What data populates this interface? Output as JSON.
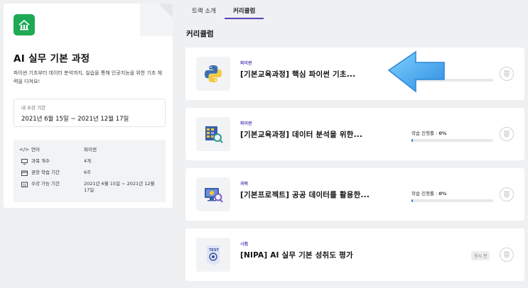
{
  "course": {
    "title": "AI 실무 기본 과정",
    "description": "파이썬 기초부터 데이터 분석까지, 실습을 통해 인공지능을 위한 기초 체력을 다져요!",
    "period_label": "내 수강 기간",
    "period_value": "2021년 6월 15일 ~ 2021년 12월 17일",
    "brand_color": "#1fa955"
  },
  "info": [
    {
      "icon": "code-icon",
      "label": "언어",
      "value": "파이썬"
    },
    {
      "icon": "monitor-icon",
      "label": "과목 개수",
      "value": "4개"
    },
    {
      "icon": "calendar-week-icon",
      "label": "권장 학습 기간",
      "value": "6주"
    },
    {
      "icon": "calendar-icon",
      "label": "수강 가능 기간",
      "value": "2021년 6월 15일 ~ 2021년 12월 17일"
    }
  ],
  "tabs": [
    {
      "label": "트랙 소개",
      "active": false
    },
    {
      "label": "커리큘럼",
      "active": true
    }
  ],
  "section_title": "커리큘럼",
  "courses": [
    {
      "category": "파이썬",
      "title": "[기본교육과정] 핵심 파이썬 기초...",
      "thumb": "python-logo-icon",
      "progress": 0
    },
    {
      "category": "파이썬",
      "title": "[기본교육과정] 데이터 분석을 위한...",
      "thumb": "data-analysis-icon",
      "progress_label": "학습 진행률 :",
      "progress_text": "0%",
      "progress": 0
    },
    {
      "category": "과목",
      "title": "[기본프로젝트] 공공 데이터를 활용한...",
      "thumb": "monitor-search-icon",
      "progress_label": "학습 진행률 :",
      "progress_text": "0%",
      "progress": 0
    },
    {
      "category": "시험",
      "title": "[NIPA] AI 실무 기본 성취도 평가",
      "thumb": "test-badge-icon",
      "tag": "응시 전"
    }
  ],
  "accent_color": "#5a44b8",
  "progress_color": "#3a7de0"
}
